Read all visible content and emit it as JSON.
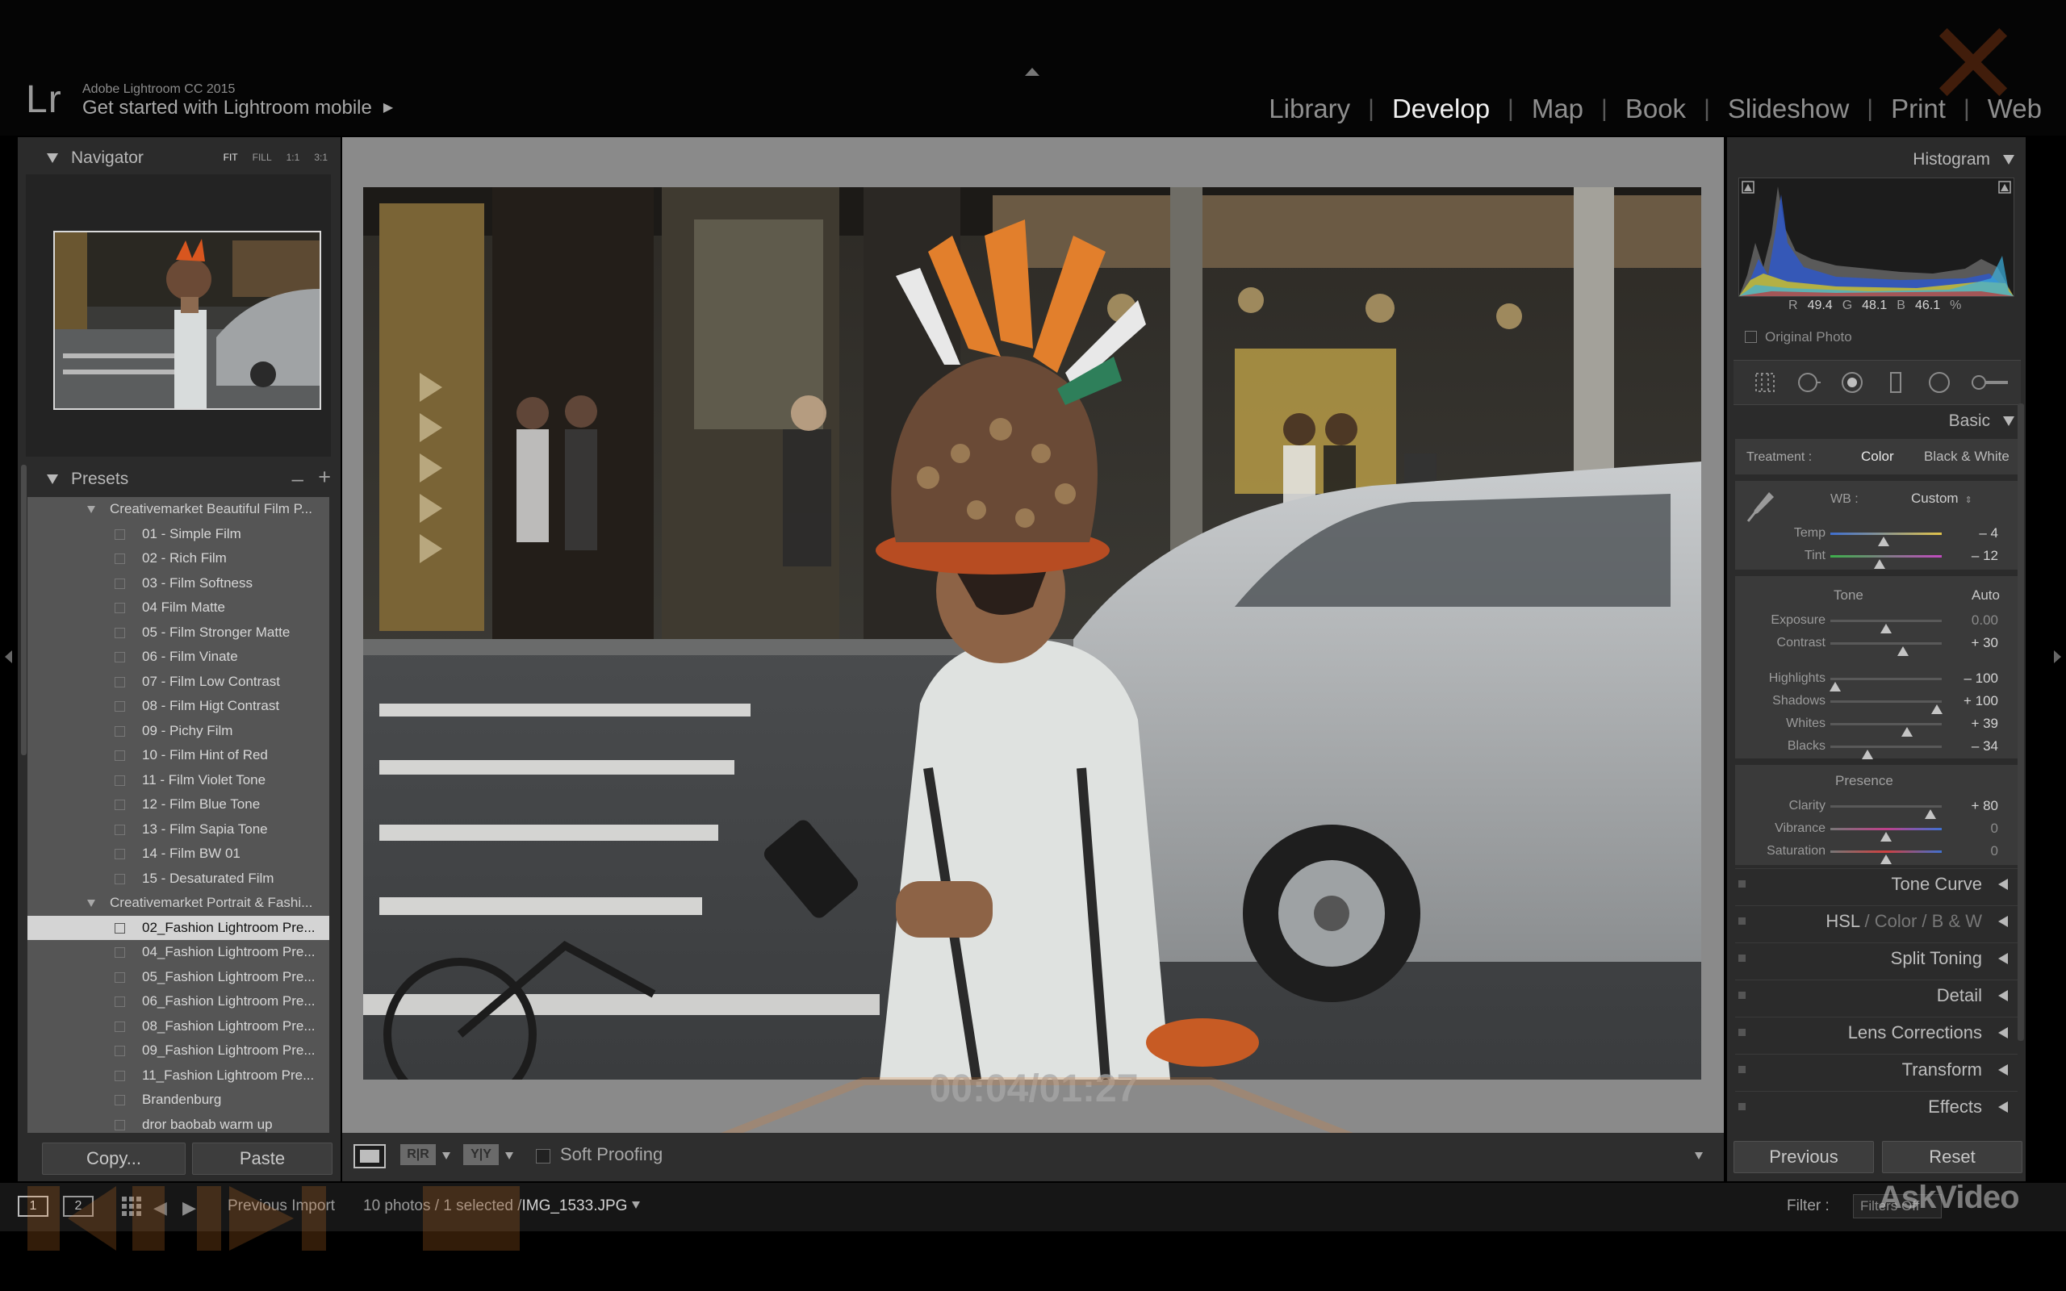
{
  "app": {
    "logo": "Lr",
    "version": "Adobe Lightroom CC 2015",
    "mobile_promo": "Get started with Lightroom mobile",
    "promo_arrow": "▶"
  },
  "modules": [
    {
      "label": "Library",
      "active": false
    },
    {
      "label": "Develop",
      "active": true
    },
    {
      "label": "Map",
      "active": false
    },
    {
      "label": "Book",
      "active": false
    },
    {
      "label": "Slideshow",
      "active": false
    },
    {
      "label": "Print",
      "active": false
    },
    {
      "label": "Web",
      "active": false
    }
  ],
  "navigator": {
    "title": "Navigator",
    "zoom_options": [
      "FIT",
      "FILL",
      "1:1",
      "3:1"
    ],
    "zoom_active": "FIT"
  },
  "presets": {
    "title": "Presets",
    "minus": "–",
    "plus": "+",
    "items": [
      {
        "type": "folder",
        "label": "Creativemarket Beautiful Film P..."
      },
      {
        "type": "preset",
        "label": "01 - Simple Film",
        "selected": false
      },
      {
        "type": "preset",
        "label": "02 - Rich Film",
        "selected": false
      },
      {
        "type": "preset",
        "label": "03 - Film Softness",
        "selected": false
      },
      {
        "type": "preset",
        "label": "04 Film Matte",
        "selected": false
      },
      {
        "type": "preset",
        "label": "05 - Film Stronger Matte",
        "selected": false
      },
      {
        "type": "preset",
        "label": "06 - Film Vinate",
        "selected": false
      },
      {
        "type": "preset",
        "label": "07 - Film Low Contrast",
        "selected": false
      },
      {
        "type": "preset",
        "label": "08 - Film Higt Contrast",
        "selected": false
      },
      {
        "type": "preset",
        "label": "09 - Pichy Film",
        "selected": false
      },
      {
        "type": "preset",
        "label": "10 - Film Hint of Red",
        "selected": false
      },
      {
        "type": "preset",
        "label": "11 - Film Violet Tone",
        "selected": false
      },
      {
        "type": "preset",
        "label": "12 - Film Blue Tone",
        "selected": false
      },
      {
        "type": "preset",
        "label": "13 - Film Sapia Tone",
        "selected": false
      },
      {
        "type": "preset",
        "label": "14 - Film BW 01",
        "selected": false
      },
      {
        "type": "preset",
        "label": "15 - Desaturated Film",
        "selected": false
      },
      {
        "type": "folder",
        "label": "Creativemarket Portrait & Fashi..."
      },
      {
        "type": "preset",
        "label": "02_Fashion Lightroom Pre...",
        "selected": true
      },
      {
        "type": "preset",
        "label": "04_Fashion Lightroom Pre...",
        "selected": false
      },
      {
        "type": "preset",
        "label": "05_Fashion Lightroom Pre...",
        "selected": false
      },
      {
        "type": "preset",
        "label": "06_Fashion Lightroom Pre...",
        "selected": false
      },
      {
        "type": "preset",
        "label": "08_Fashion Lightroom Pre...",
        "selected": false
      },
      {
        "type": "preset",
        "label": "09_Fashion Lightroom Pre...",
        "selected": false
      },
      {
        "type": "preset",
        "label": "11_Fashion Lightroom Pre...",
        "selected": false
      },
      {
        "type": "preset",
        "label": "Brandenburg",
        "selected": false
      },
      {
        "type": "preset",
        "label": "dror baobab warm up",
        "selected": false
      }
    ]
  },
  "left_buttons": {
    "copy": "Copy...",
    "paste": "Paste"
  },
  "center": {
    "timecode": "00:04/01:27",
    "toolbar": {
      "before_after": "R|R",
      "yy": "Y|Y",
      "soft_proofing": "Soft Proofing",
      "soft_proofing_checked": false
    }
  },
  "histogram": {
    "title": "Histogram",
    "r_label": "R",
    "r_value": "49.4",
    "g_label": "G",
    "g_value": "48.1",
    "b_label": "B",
    "b_value": "46.1",
    "percent": "%",
    "original_photo": "Original Photo"
  },
  "tools": [
    "crop-overlay-icon",
    "spot-removal-icon",
    "red-eye-icon",
    "graduated-filter-icon",
    "radial-filter-icon",
    "adjustment-brush-icon"
  ],
  "basic": {
    "title": "Basic",
    "treatment_label": "Treatment :",
    "treatment_color": "Color",
    "treatment_bw": "Black & White",
    "wb_label": "WB :",
    "wb_value": "Custom",
    "wb_arrow": "⇕",
    "tone_label": "Tone",
    "auto_label": "Auto",
    "presence_label": "Presence",
    "wb_sliders": [
      {
        "label": "Temp",
        "value": "– 4",
        "position": 0.48
      },
      {
        "label": "Tint",
        "value": "– 12",
        "position": 0.44
      }
    ],
    "tone_sliders": [
      {
        "label": "Exposure",
        "value": "0.00",
        "position": 0.5,
        "muted": true
      },
      {
        "label": "Contrast",
        "value": "+ 30",
        "position": 0.65,
        "muted": false
      },
      {
        "label": "Highlights",
        "value": "– 100",
        "position": 0.04,
        "muted": false
      },
      {
        "label": "Shadows",
        "value": "+ 100",
        "position": 0.96,
        "muted": false
      },
      {
        "label": "Whites",
        "value": "+ 39",
        "position": 0.69,
        "muted": false
      },
      {
        "label": "Blacks",
        "value": "– 34",
        "position": 0.33,
        "muted": false
      }
    ],
    "presence_sliders": [
      {
        "label": "Clarity",
        "value": "+ 80",
        "position": 0.9,
        "muted": false
      },
      {
        "label": "Vibrance",
        "value": "0",
        "position": 0.5,
        "muted": true
      },
      {
        "label": "Saturation",
        "value": "0",
        "position": 0.5,
        "muted": true
      }
    ]
  },
  "collapsed_panels": {
    "tone_curve": "Tone Curve",
    "hsl": "HSL",
    "hsl_color": "Color",
    "hsl_bw": "B & W",
    "hsl_sep": "/",
    "split_toning": "Split Toning",
    "detail": "Detail",
    "lens_corrections": "Lens Corrections",
    "transform": "Transform",
    "effects": "Effects"
  },
  "right_buttons": {
    "previous": "Previous",
    "reset": "Reset"
  },
  "filmstrip": {
    "screen1": "1",
    "screen2": "2",
    "source": "Previous Import",
    "count": "10 photos / 1 selected /",
    "filename": "IMG_1533.JPG",
    "filter_label": "Filter :",
    "filter_value": "Filters Off",
    "watermark": "AskVideo"
  },
  "colors": {
    "panel_bg": "#2b2b2b",
    "center_bg": "#8a8a8a",
    "selected_preset": "#d4d4d4",
    "accent_orange": "#e27f2c"
  }
}
